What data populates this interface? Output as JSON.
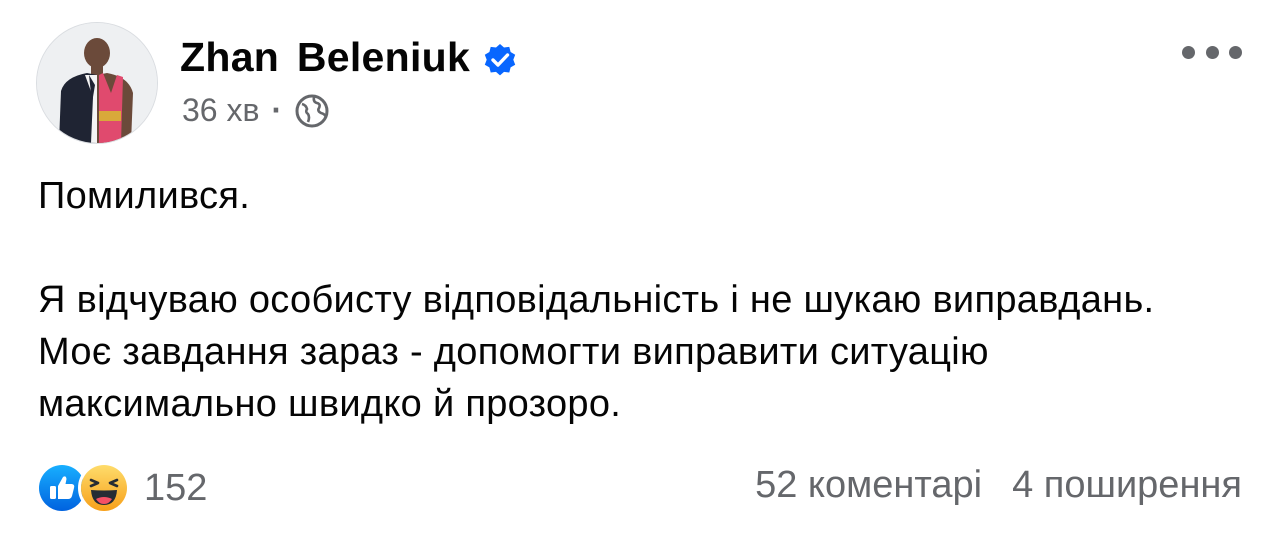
{
  "author": {
    "name": "Zhan  Beleniuk",
    "verified": true
  },
  "meta": {
    "time": "36 хв",
    "separator": "·",
    "audience_icon": "globe-icon"
  },
  "post": {
    "paragraphs": [
      "Помилився.",
      "Я відчуваю особисту відповідальність і не шукаю виправдань. Моє завдання зараз - допомогти виправити ситуацію максимально швидко й прозоро."
    ]
  },
  "reactions": {
    "icons": [
      "like-icon",
      "haha-icon"
    ],
    "count": "152"
  },
  "stats": {
    "comments": "52 коментарі",
    "shares": "4 поширення"
  },
  "colors": {
    "verified": "#0866ff",
    "secondary_text": "#65676b",
    "like_blue": "#1877f2",
    "haha_yellow": "#f7b125"
  }
}
